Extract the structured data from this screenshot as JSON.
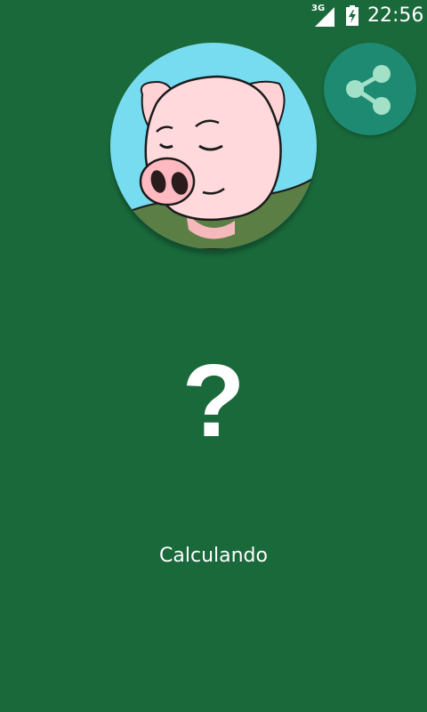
{
  "status_bar": {
    "network_type": "3G",
    "time": "22:56",
    "signal_icon": "signal-icon",
    "battery_icon": "battery-charging-icon"
  },
  "avatar": {
    "icon": "pig-face-icon",
    "background_color": "#78dcf0"
  },
  "share": {
    "icon": "share-icon",
    "background_color": "#1e8a71"
  },
  "result": {
    "symbol": "?",
    "status_text": "Calculando"
  },
  "theme": {
    "background_color": "#19693b"
  }
}
